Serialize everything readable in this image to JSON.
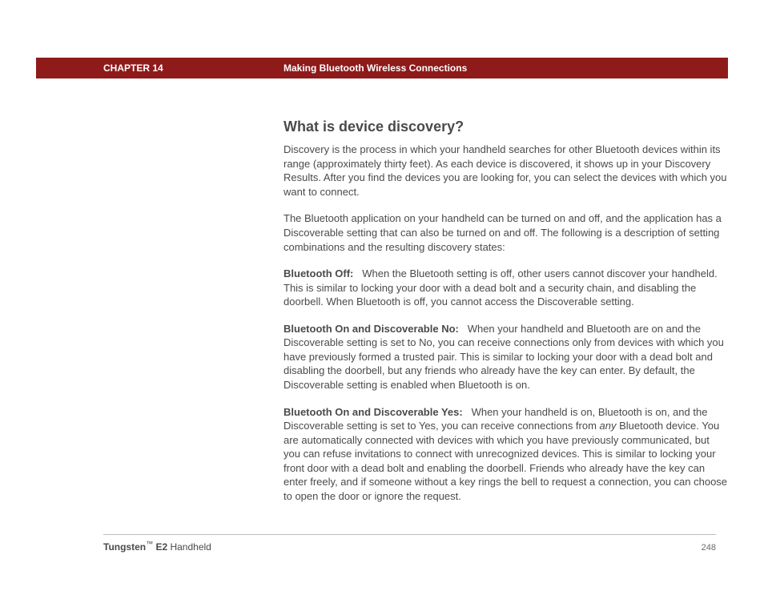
{
  "header": {
    "chapter": "CHAPTER 14",
    "title": "Making Bluetooth Wireless Connections"
  },
  "section": {
    "heading": "What is device discovery?",
    "intro1": "Discovery is the process in which your handheld searches for other Bluetooth devices within its range (approximately thirty feet). As each device is discovered, it shows up in your Discovery Results. After you find the devices you are looking for, you can select the devices with which you want to connect.",
    "intro2": "The Bluetooth application on your handheld can be turned on and off, and the application has a Discoverable setting that can also be turned on and off. The following is a description of setting combinations and the resulting discovery states:",
    "items": [
      {
        "label": "Bluetooth Off:",
        "text": "When the Bluetooth setting is off, other users cannot discover your handheld. This is similar to locking your door with a dead bolt and a security chain, and disabling the doorbell. When Bluetooth is off, you cannot access the Discoverable setting."
      },
      {
        "label": "Bluetooth On and Discoverable No:",
        "text": "When your handheld and Bluetooth are on and the Discoverable setting is set to No, you can receive connections only from devices with which you have previously formed a trusted pair. This is similar to locking your door with a dead bolt and disabling the doorbell, but any friends who already have the key can enter. By default, the Discoverable setting is enabled when Bluetooth is on."
      },
      {
        "label": "Bluetooth On and Discoverable Yes:",
        "text_before": "When your handheld is on, Bluetooth is on, and the Discoverable setting is set to Yes, you can receive connections from ",
        "italic": "any",
        "text_after": " Bluetooth device. You are automatically connected with devices with which you have previously communicated, but you can refuse invitations to connect with unrecognized devices. This is similar to locking your front door with a dead bolt and enabling the doorbell. Friends who already have the key can enter freely, and if someone without a key rings the bell to request a connection, you can choose to open the door or ignore the request."
      }
    ]
  },
  "footer": {
    "product": "Tungsten",
    "tm": "™",
    "variant": " E2",
    "suffix": " Handheld",
    "page": "248"
  }
}
